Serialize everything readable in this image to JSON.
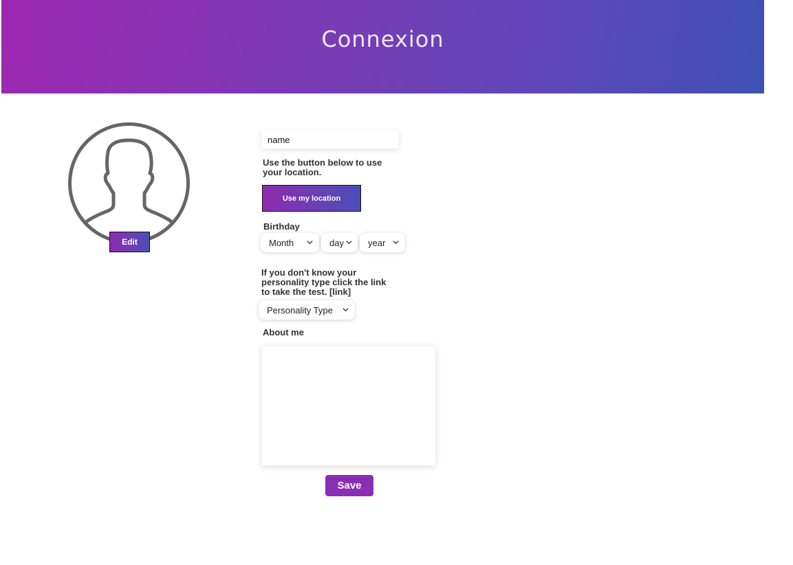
{
  "header": {
    "title": "Connexion",
    "gradient_start": "#9c27b0",
    "gradient_end": "#3f51b5"
  },
  "avatar": {
    "icon": "user-silhouette-icon",
    "edit_label": "Edit"
  },
  "form": {
    "name_placeholder": "name",
    "location_hint": "Use the button below to use your location.",
    "location_button": "Use my location",
    "birthday_label": "Birthday",
    "month_select": "Month",
    "day_select": "day",
    "year_select": "year",
    "personality_hint": "If you don't know your personality type click the link to take the test. [link]",
    "personality_select": "Personality Type",
    "about_label": "About me",
    "about_value": "",
    "save_button": "Save"
  },
  "colors": {
    "accent": "#8a2fb5",
    "text": "#333333"
  }
}
